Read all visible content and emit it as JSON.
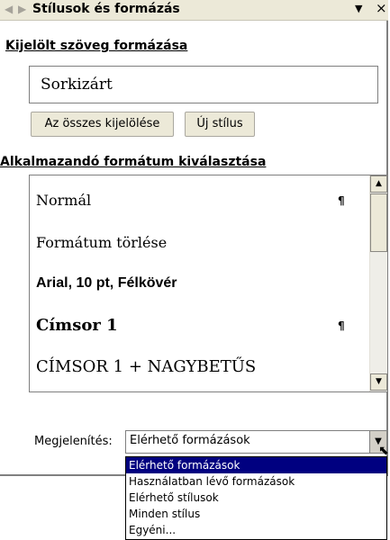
{
  "panel": {
    "title": "Stílusok és formázás"
  },
  "selected_text_section": {
    "heading": "Kijelölt szöveg formázása",
    "current_format": "Sorkizárt",
    "select_all_label": "Az összes kijelölése",
    "new_style_label": "Új stílus"
  },
  "apply_section": {
    "heading": "Alkalmazandó formátum kiválasztása",
    "items": [
      {
        "label": "Normál",
        "mark": "¶"
      },
      {
        "label": "Formátum törlése",
        "mark": ""
      },
      {
        "label": "Arial, 10 pt, Félkövér",
        "mark": ""
      },
      {
        "label": "Címsor 1",
        "mark": "¶"
      },
      {
        "label": "CÍMSOR 1 + NAGYBETŰS",
        "mark": ""
      }
    ]
  },
  "show": {
    "label": "Megjelenítés:",
    "value": "Elérhető formázások",
    "options": [
      "Elérhető formázások",
      "Használatban lévő formázások",
      "Elérhető stílusok",
      "Minden stílus",
      "Egyéni..."
    ]
  }
}
